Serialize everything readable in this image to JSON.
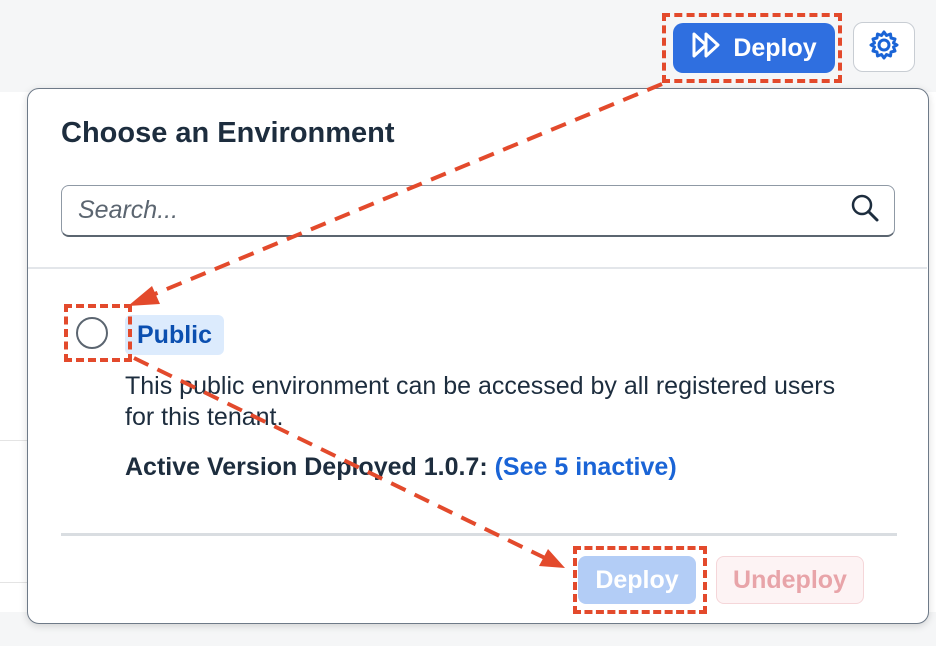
{
  "toolbar": {
    "deploy_label": "Deploy",
    "settings_icon": "gear-icon",
    "deploy_icon": "double-chevron-right-icon"
  },
  "popover": {
    "title": "Choose an Environment",
    "search": {
      "placeholder": "Search...",
      "value": ""
    },
    "environment": {
      "tag": "Public",
      "description": "This public environment can be accessed by all registered users for this tenant.",
      "active_version_label": "Active Version Deployed 1.0.7:",
      "inactive_link": "(See 5 inactive)"
    },
    "actions": {
      "deploy_label": "Deploy",
      "undeploy_label": "Undeploy"
    }
  },
  "colors": {
    "primary": "#2f6fe0",
    "annotation": "#e34a2c",
    "link": "#1a64d6",
    "tag_bg": "#dcebfd"
  }
}
